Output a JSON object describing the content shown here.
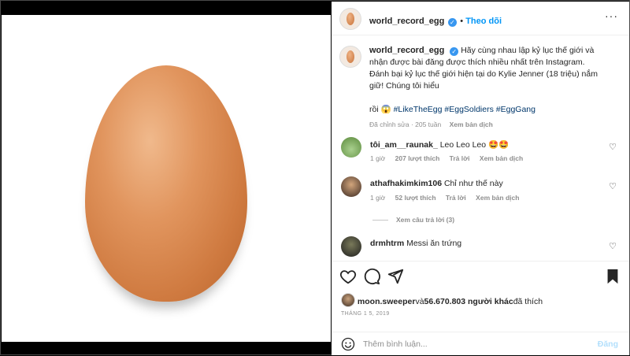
{
  "post": {
    "username": "world_record_egg",
    "follow_label": "Theo dõi",
    "caption_text": "Hãy cùng nhau lập kỷ lục thế giới và nhận được bài đăng được thích nhiều nhất trên Instagram. Đánh bại kỷ lục thế giới hiện tại do Kylie Jenner (18 triệu) nắm giữ! Chúng tôi hiểu",
    "caption_cont": "rồi 😱",
    "hashtags": "#LikeTheEgg #EggSoldiers #EggGang",
    "edited": "Đã chỉnh sửa · 205 tuần",
    "translate": "Xem bản dịch"
  },
  "comments": [
    {
      "user": "tôi_am__raunak_",
      "text": "Leo Leo Leo 🤩🤩",
      "time": "1 giờ",
      "likes": "207 lượt thích",
      "reply": "Trả lời",
      "translate": "Xem bản dịch"
    },
    {
      "user": "athafhakimkim106",
      "text": "Chỉ như thế này",
      "time": "1 giờ",
      "likes": "52 lượt thích",
      "reply": "Trả lời",
      "translate": "Xem bản dịch"
    },
    {
      "user": "drmhtrm",
      "text": "Messi ăn trứng"
    }
  ],
  "view_replies": "Xem câu trả lời (3)",
  "likes_line": {
    "user": "moon.sweeper",
    "mid": "và",
    "count": "56.670.803 người khác",
    "end": "đã thích"
  },
  "date": "THÁNG 1 5, 2019",
  "add_comment": {
    "placeholder": "Thêm bình luận...",
    "post": "Đăng"
  }
}
